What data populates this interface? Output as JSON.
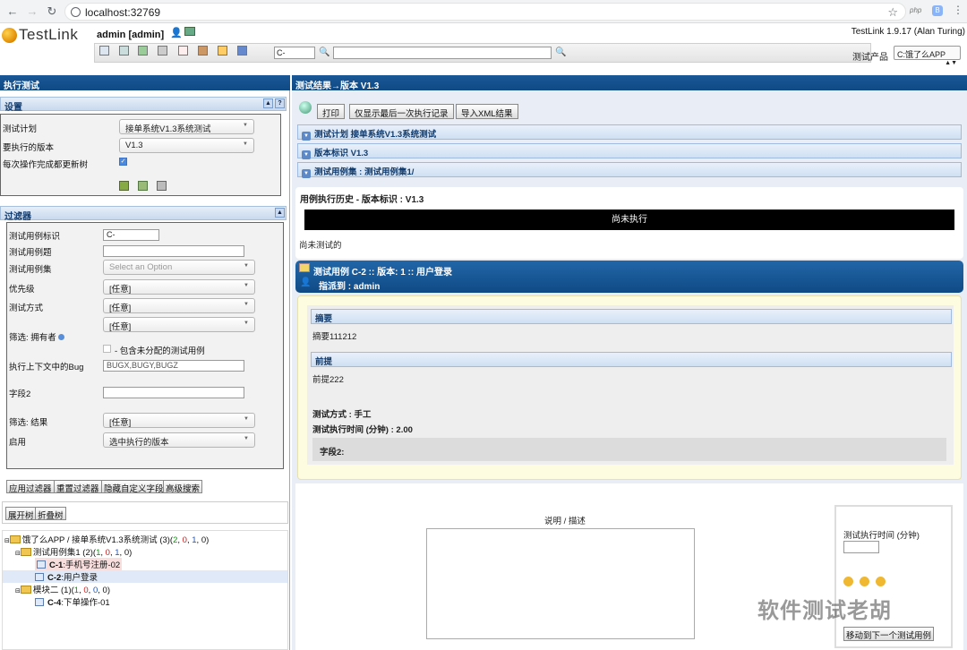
{
  "browser": {
    "url": "localhost:32769",
    "ext_php": "php",
    "ext_b": "B"
  },
  "header": {
    "logo_text": "TestLink",
    "user": "admin [admin]",
    "version": "TestLink 1.9.17 (Alan Turing)",
    "tc_id_value": "C-",
    "search_value": "",
    "product_label": "测试产品",
    "product_value": "C:饿了么APP"
  },
  "left": {
    "title": "执行测试",
    "settings": {
      "title": "设置",
      "help": "?",
      "plan_label": "测试计划",
      "plan_value": "接单系统V1.3系统测试",
      "build_label": "要执行的版本",
      "build_value": "V1.3",
      "refresh_label": "每次操作完成都更新树",
      "refresh_checked": true
    },
    "filters": {
      "title": "过滤器",
      "tc_id_label": "测试用例标识",
      "tc_id_value": "C-",
      "tc_title_label": "测试用例题",
      "tc_title_value": "",
      "suite_label": "测试用例集",
      "suite_placeholder": "Select an Option",
      "priority_label": "优先级",
      "priority_value": "[任意]",
      "exec_type_label": "测试方式",
      "exec_type_value": "[任意]",
      "owner_value": "[任意]",
      "owner_label": "筛选: 拥有者",
      "unassigned_label": "- 包含未分配的测试用例",
      "bug_label": "执行上下文中的Bug",
      "bug_value": "BUGX,BUGY,BUGZ",
      "field2_label": "字段2",
      "field2_value": "",
      "result_label": "筛选: 结果",
      "result_value": "[任意]",
      "enable_label": "启用",
      "enable_value": "选中执行的版本"
    },
    "buttons": {
      "apply": "应用过滤器",
      "reset": "重置过滤器",
      "hide_custom": "隐藏自定义字段",
      "advanced": "高级搜索"
    },
    "tree_buttons": {
      "expand": "展开树",
      "collapse": "折叠树"
    },
    "tree": [
      {
        "prefix": "饿了么APP / 接单系统V1.3系统测试 (3)(",
        "counts": [
          "2",
          "0",
          "1",
          "0"
        ],
        "suffix": ")"
      },
      {
        "prefix": "测试用例集1 (2)(",
        "counts": [
          "1",
          "0",
          "1",
          "0"
        ],
        "suffix": ")"
      },
      {
        "id": "C-1",
        "name": ":手机号注册-02"
      },
      {
        "id": "C-2",
        "name": ":用户登录"
      },
      {
        "prefix": "模块二 (1)(",
        "counts": [
          "1",
          "0",
          "0",
          "0"
        ],
        "suffix": ")"
      },
      {
        "id": "C-4",
        "name": ":下单操作-01"
      }
    ]
  },
  "right": {
    "title": "测试结果→版本 V1.3",
    "buttons": {
      "print": "打印",
      "last_only": "仅显示最后一次执行记录",
      "export_xml": "导入XML结果"
    },
    "sections": [
      "测试计划 接单系统V1.3系统测试",
      "版本标识 V1.3",
      "测试用例集 : 测试用例集1/"
    ],
    "history_title": "用例执行历史 - 版本标识 : V1.3",
    "not_run_banner": "尚未执行",
    "not_tested": "尚未测试的",
    "tc_header": "测试用例 C-2 :: 版本: 1 :: 用户登录",
    "assigned": "指派到 : admin",
    "summary_title": "摘要",
    "summary_text": "摘要111212",
    "precond_title": "前提",
    "precond_text": "前提222",
    "exec_type": "测试方式 : 手工",
    "exec_duration": "测试执行时间 (分钟) : 2.00",
    "field2": "字段2:",
    "notes_label": "说明 / 描述",
    "side": {
      "duration_label": "测试执行时间 (分钟)",
      "move_next": "移动到下一个测试用例"
    },
    "watermark": "软件测试老胡"
  },
  "colors": {
    "nav_blue": "#0f4a85",
    "pass": "#1b8a1b",
    "fail": "#c81e1e",
    "blocked": "#1c56b8",
    "not_run": "#000000"
  }
}
